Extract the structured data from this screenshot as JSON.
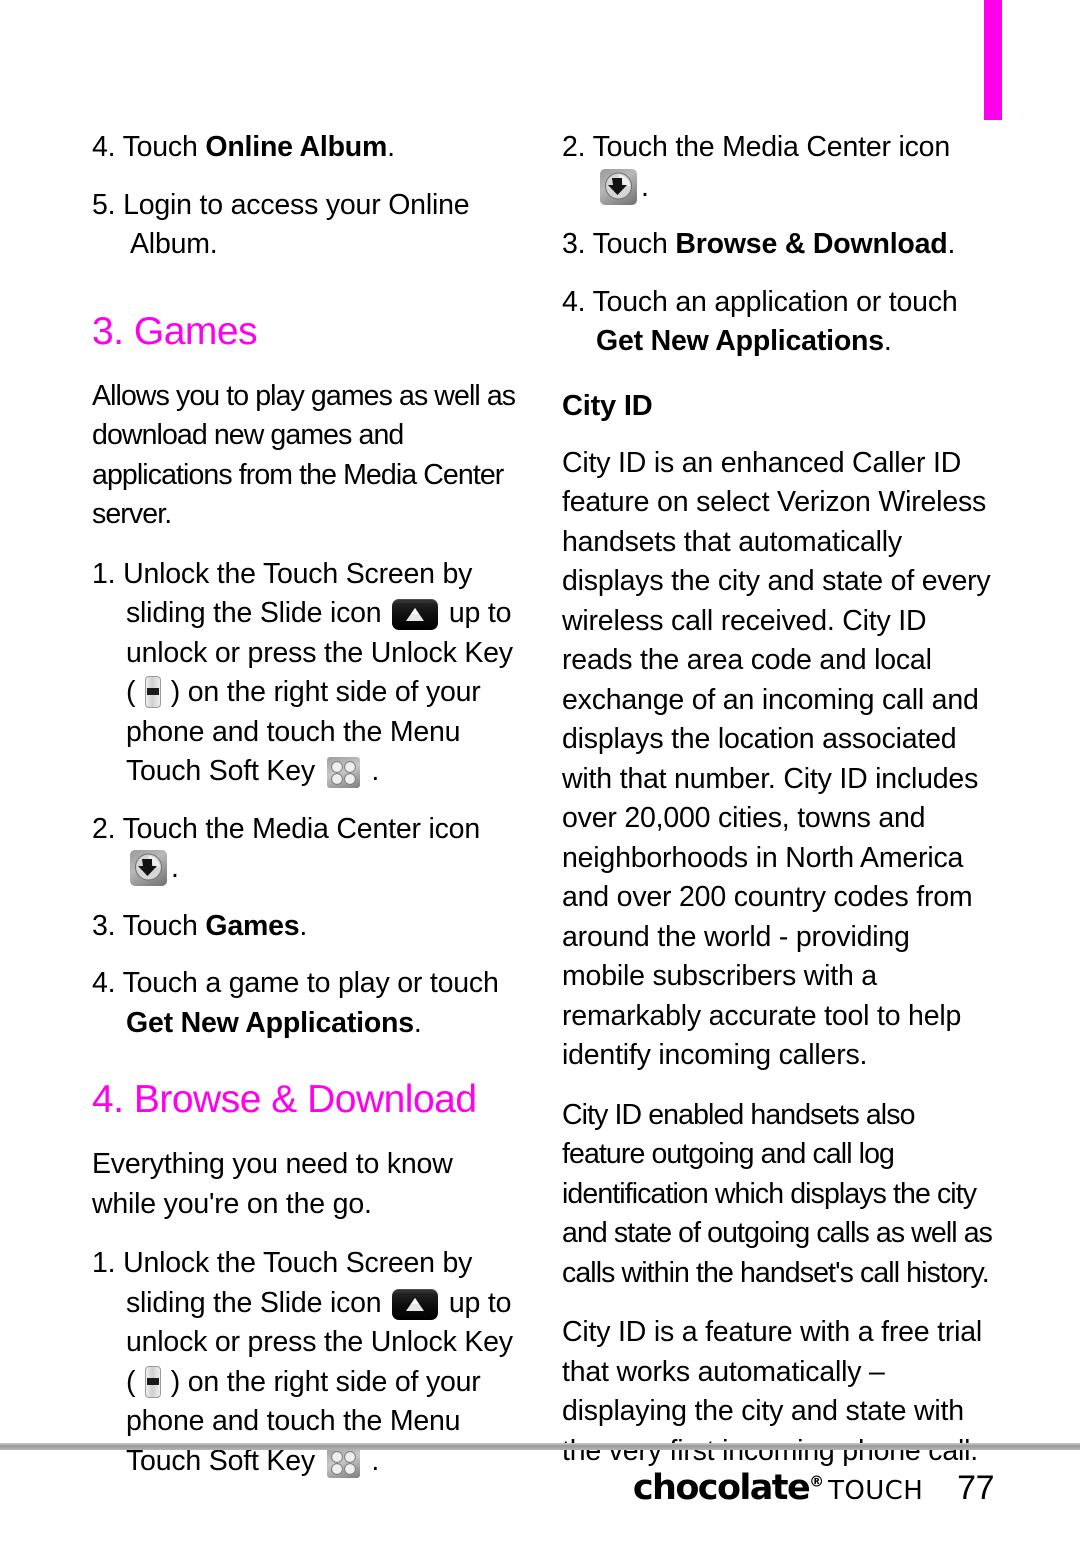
{
  "page": {
    "number": "77",
    "chapter_tab_color": "#ff00ee",
    "heading_color": "#ff00ee"
  },
  "footer": {
    "brand": "chocolate",
    "brand_mark": "®",
    "brand_suffix": "TOUCH",
    "page_number": "77"
  },
  "left_column": {
    "item_4_online_album": {
      "num": "4.",
      "text_before": " Touch ",
      "bold": "Online Album",
      "text_after": "."
    },
    "item_5_login": {
      "num": "5.",
      "text": "  Login to access your Online Album."
    },
    "heading_games": "3. Games",
    "games_intro": "Allows you to play games as well as download new games and applications from the Media Center server.",
    "games_step_1": {
      "num": "1.",
      "part_a": " Unlock the Touch Screen by sliding the Slide icon ",
      "part_b": " up to unlock or press the Unlock Key ( ",
      "part_c": " ) on the right side of your phone and touch the Menu Touch Soft Key ",
      "part_d": " ."
    },
    "games_step_2": {
      "num": "2.",
      "part_a": " Touch the Media Center icon ",
      "part_b": "."
    },
    "games_step_3": {
      "num": "3.",
      "text_before": " Touch ",
      "bold": "Games",
      "text_after": "."
    },
    "games_step_4": {
      "num": "4.",
      "text_before": " Touch a game to play or touch ",
      "bold": "Get New Applications",
      "text_after": "."
    },
    "heading_browse": "4. Browse & Download",
    "browse_intro": "Everything you need to know while you're on the go.",
    "browse_step_1": {
      "num": "1.",
      "part_a": " Unlock the Touch Screen by sliding the Slide icon ",
      "part_b": " up to unlock or press the Unlock Key ( ",
      "part_c": " ) on the right side of your phone and touch the Menu Touch Soft Key ",
      "part_d": " ."
    }
  },
  "right_column": {
    "browse_step_2": {
      "num": "2.",
      "part_a": " Touch the Media Center icon ",
      "part_b": "."
    },
    "browse_step_3": {
      "num": "3.",
      "text_before": " Touch ",
      "bold": "Browse & Download",
      "text_after": "."
    },
    "browse_step_4": {
      "num": "4.",
      "text_before": " Touch an application or touch ",
      "bold": "Get New Applications",
      "text_after": "."
    },
    "sub_head_city_id": "City ID",
    "city_id_para_1": "City ID is an enhanced Caller ID feature on select Verizon Wireless handsets that automatically displays the city and state of every wireless call received. City ID reads the area code and local exchange of an incoming call and displays the location associated with that number.  City ID includes over 20,000 cities, towns and neighborhoods in North America and over 200 country codes from around the world - providing mobile subscribers with a remarkably accurate tool to help identify incoming callers.",
    "city_id_para_2": "City ID enabled handsets also feature outgoing and call log identification which displays the city and state of outgoing calls as well as calls within the handset's call history.",
    "city_id_para_3": "City ID is a feature with a free trial that works automatically – displaying the city and state with the very first incoming phone call."
  },
  "icons": {
    "slide": "slide-icon",
    "unlock_key": "unlock-key-icon",
    "menu_soft_key": "menu-touch-soft-key-icon",
    "media_center": "media-center-icon"
  }
}
